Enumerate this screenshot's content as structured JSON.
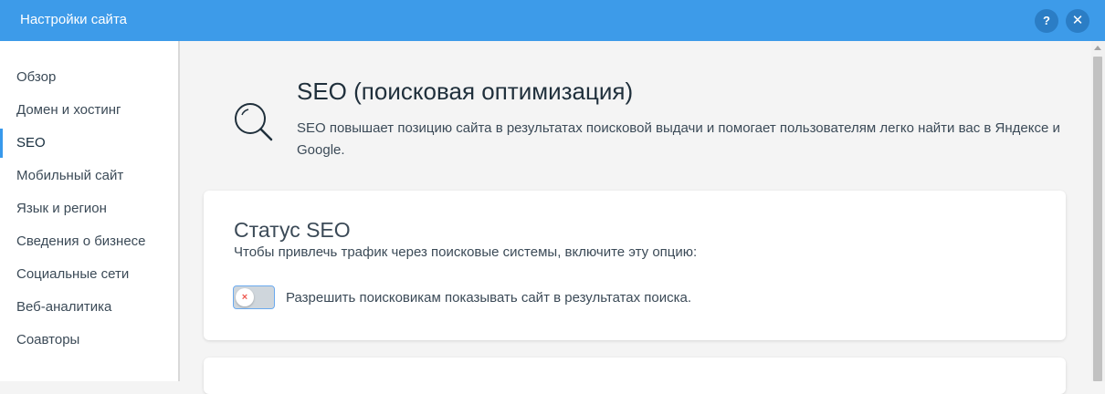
{
  "window": {
    "title": "Настройки сайта",
    "help_label": "?",
    "close_label": "✕"
  },
  "sidebar": {
    "items": [
      {
        "label": "Обзор"
      },
      {
        "label": "Домен и хостинг"
      },
      {
        "label": "SEO",
        "active": true
      },
      {
        "label": "Мобильный сайт"
      },
      {
        "label": "Язык и регион"
      },
      {
        "label": "Сведения о бизнесе"
      },
      {
        "label": "Социальные сети"
      },
      {
        "label": "Веб-аналитика"
      },
      {
        "label": "Соавторы"
      }
    ]
  },
  "main": {
    "icon": "search-icon",
    "title": "SEO (поисковая оптимизация)",
    "description": "SEO повышает позицию сайта в результатах поисковой выдачи и помогает пользователям легко найти вас в Яндексе и Google.",
    "status_card": {
      "title": "Статус SEO",
      "subtitle": "Чтобы привлечь трафик через поисковые системы, включите эту опцию:",
      "toggle_state": "off",
      "toggle_mark": "×",
      "toggle_label": "Разрешить поисковикам показывать сайт в результатах поиска."
    }
  },
  "colors": {
    "header": "#3d9be9",
    "accent": "#3899ec",
    "toggle_off_mark": "#ee5951"
  }
}
